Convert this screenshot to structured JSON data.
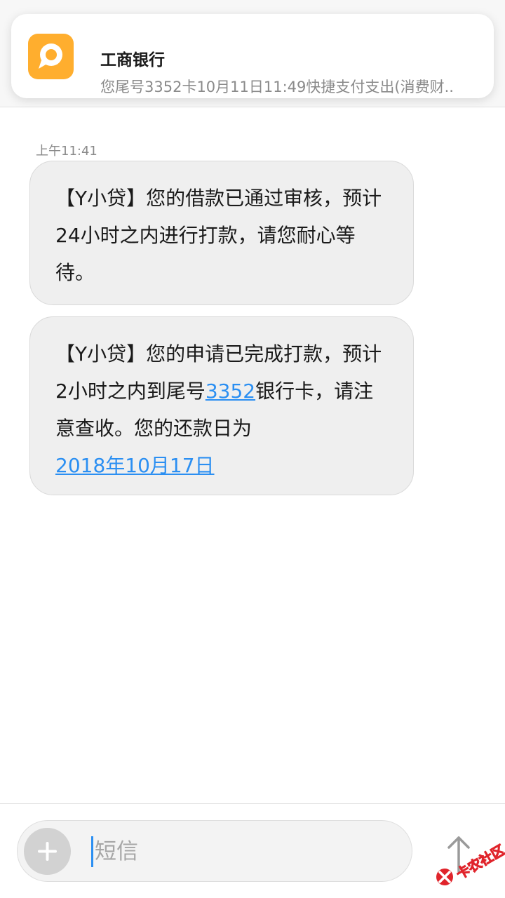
{
  "notification": {
    "app_icon": "message-bubble-icon",
    "title": "工商银行",
    "body": "您尾号3352卡10月11日11:49快捷支付支出(消费财..",
    "icon_color": "#ffae2e"
  },
  "conversation": {
    "timestamp": "上午11:41",
    "messages": [
      {
        "text": "【Y小贷】您的借款已通过审核，预计24小时之内进行打款，请您耐心等待。"
      },
      {
        "text_before": "【Y小贷】您的申请已完成打款，预计2小时之内到尾号",
        "card_link": "3352",
        "text_middle": "银行卡，请注意查收。您的还款日为",
        "date_link": "2018年10月17日"
      }
    ]
  },
  "composer": {
    "add_icon": "plus-icon",
    "placeholder": "短信",
    "send_icon": "arrow-up-icon"
  },
  "watermark": {
    "text": "卡农社区",
    "icon": "brand-logo-icon"
  },
  "colors": {
    "link": "#2b8ff2",
    "bubble_bg": "#efefef",
    "accent_orange": "#ffae2e"
  }
}
